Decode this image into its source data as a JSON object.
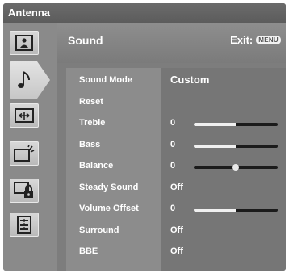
{
  "window": {
    "title": "Antenna"
  },
  "sidebar": {
    "items": [
      {
        "icon": "picture-icon",
        "active": false
      },
      {
        "icon": "music-note-icon",
        "active": true
      },
      {
        "icon": "screen-adjust-icon",
        "active": false
      },
      {
        "icon": "tv-feature-icon",
        "active": false
      },
      {
        "icon": "lock-icon",
        "active": false
      },
      {
        "icon": "setup-icon",
        "active": false
      }
    ]
  },
  "panel": {
    "title": "Sound",
    "exit_label": "Exit:",
    "menu_key": "MENU"
  },
  "settings": [
    {
      "label": "Sound Mode",
      "value": "Custom"
    },
    {
      "label": "Reset",
      "value": ""
    },
    {
      "label": "Treble",
      "value": "0",
      "slider_level": 0.5
    },
    {
      "label": "Bass",
      "value": "0",
      "slider_level": 0.5
    },
    {
      "label": "Balance",
      "value": "0",
      "balance_level": 0.5
    },
    {
      "label": "Steady Sound",
      "value": "Off"
    },
    {
      "label": "Volume Offset",
      "value": "0",
      "slider_level": 0.5
    },
    {
      "label": "Surround",
      "value": "Off"
    },
    {
      "label": "BBE",
      "value": "Off"
    }
  ]
}
